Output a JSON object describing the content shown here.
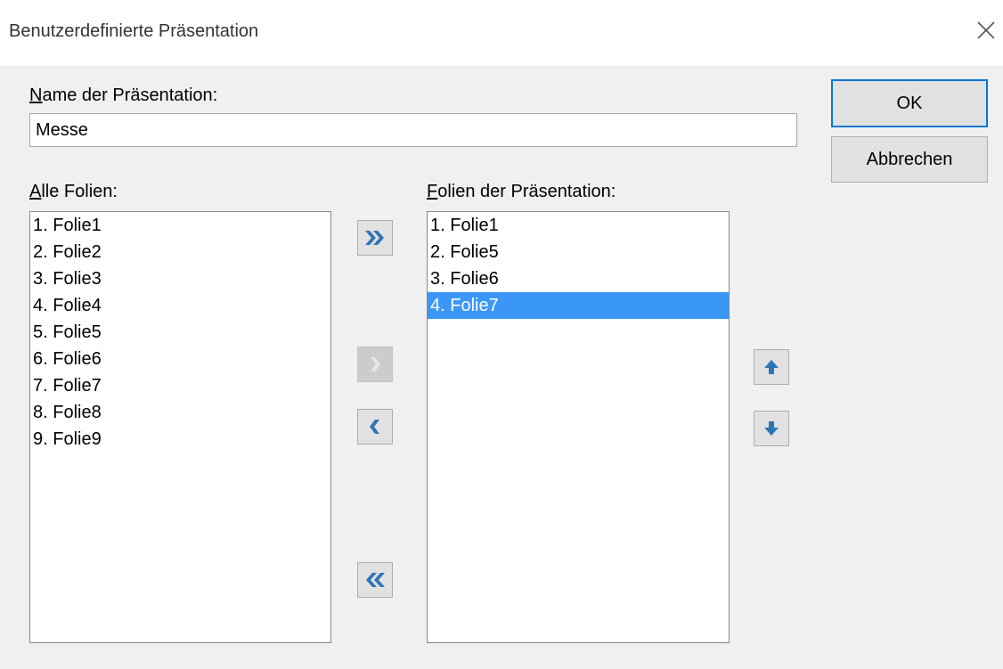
{
  "window": {
    "title": "Benutzerdefinierte Präsentation",
    "close_icon": "close-icon"
  },
  "name_field": {
    "label_access": "N",
    "label_rest": "ame der Präsentation:",
    "value": "Messe"
  },
  "buttons": {
    "ok_label": "OK",
    "cancel_label": "Abbrechen"
  },
  "all_slides": {
    "label_access": "A",
    "label_rest": "lle Folien:",
    "items": [
      "1. Folie1",
      "2. Folie2",
      "3. Folie3",
      "4. Folie4",
      "5. Folie5",
      "6. Folie6",
      "7. Folie7",
      "8. Folie8",
      "9. Folie9"
    ]
  },
  "presentation_slides": {
    "label_access": "F",
    "label_rest": "olien der Präsentation:",
    "items": [
      "1. Folie1",
      "2. Folie5",
      "3. Folie6",
      "4. Folie7"
    ],
    "selected_index": 3
  },
  "transfer_buttons": {
    "add_all_icon": "double-chevron-right-icon",
    "add_icon": "chevron-right-icon",
    "add_enabled": false,
    "remove_icon": "chevron-left-icon",
    "remove_all_icon": "double-chevron-left-icon"
  },
  "order_buttons": {
    "up_icon": "arrow-up-icon",
    "down_icon": "arrow-down-icon"
  },
  "colors": {
    "accent": "#0078d7",
    "icon_blue": "#2e75b6",
    "selection": "#3a97f5",
    "disabled_icon": "#e6e6e6"
  }
}
